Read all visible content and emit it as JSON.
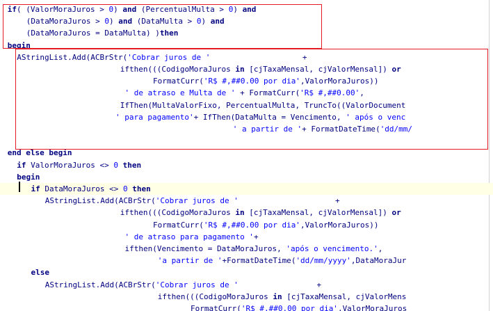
{
  "editor": {
    "lines": [
      {
        "indent": 1,
        "tokens": [
          {
            "t": "kw",
            "v": "if"
          },
          {
            "t": "sym",
            "v": "( ("
          },
          {
            "t": "id",
            "v": "ValorMoraJuros"
          },
          {
            "t": "sym",
            "v": " > "
          },
          {
            "t": "num",
            "v": "0"
          },
          {
            "t": "sym",
            "v": ") "
          },
          {
            "t": "kw",
            "v": "and"
          },
          {
            "t": "sym",
            "v": " ("
          },
          {
            "t": "id",
            "v": "PercentualMulta"
          },
          {
            "t": "sym",
            "v": " > "
          },
          {
            "t": "num",
            "v": "0"
          },
          {
            "t": "sym",
            "v": ") "
          },
          {
            "t": "kw",
            "v": "and"
          }
        ]
      },
      {
        "indent": 5,
        "tokens": [
          {
            "t": "sym",
            "v": "("
          },
          {
            "t": "id",
            "v": "DataMoraJuros"
          },
          {
            "t": "sym",
            "v": " > "
          },
          {
            "t": "num",
            "v": "0"
          },
          {
            "t": "sym",
            "v": ") "
          },
          {
            "t": "kw",
            "v": "and"
          },
          {
            "t": "sym",
            "v": " ("
          },
          {
            "t": "id",
            "v": "DataMulta"
          },
          {
            "t": "sym",
            "v": " > "
          },
          {
            "t": "num",
            "v": "0"
          },
          {
            "t": "sym",
            "v": ") "
          },
          {
            "t": "kw",
            "v": "and"
          }
        ]
      },
      {
        "indent": 5,
        "tokens": [
          {
            "t": "sym",
            "v": "("
          },
          {
            "t": "id",
            "v": "DataMoraJuros"
          },
          {
            "t": "sym",
            "v": " = "
          },
          {
            "t": "id",
            "v": "DataMulta"
          },
          {
            "t": "sym",
            "v": ") )"
          },
          {
            "t": "kw",
            "v": "then"
          }
        ]
      },
      {
        "indent": 1,
        "tokens": [
          {
            "t": "kw",
            "v": "begin"
          }
        ]
      },
      {
        "indent": 3,
        "tokens": [
          {
            "t": "id",
            "v": "AStringList.Add"
          },
          {
            "t": "sym",
            "v": "("
          },
          {
            "t": "id",
            "v": "ACBrStr"
          },
          {
            "t": "sym",
            "v": "("
          },
          {
            "t": "str",
            "v": "'Cobrar juros de '"
          },
          {
            "t": "sym",
            "v": "                    +"
          }
        ]
      },
      {
        "indent": 25,
        "tokens": [
          {
            "t": "id",
            "v": "ifthen"
          },
          {
            "t": "sym",
            "v": "((("
          },
          {
            "t": "id",
            "v": "CodigoMoraJuros"
          },
          {
            "t": "sym",
            "v": " "
          },
          {
            "t": "kw",
            "v": "in"
          },
          {
            "t": "sym",
            "v": " ["
          },
          {
            "t": "id",
            "v": "cjTaxaMensal"
          },
          {
            "t": "sym",
            "v": ", "
          },
          {
            "t": "id",
            "v": "cjValorMensal"
          },
          {
            "t": "sym",
            "v": "]) "
          },
          {
            "t": "kw",
            "v": "or"
          }
        ]
      },
      {
        "indent": 32,
        "tokens": [
          {
            "t": "id",
            "v": "FormatCurr"
          },
          {
            "t": "sym",
            "v": "("
          },
          {
            "t": "str",
            "v": "'R$ #,##0.00 por dia'"
          },
          {
            "t": "sym",
            "v": ","
          },
          {
            "t": "id",
            "v": "ValorMoraJuros"
          },
          {
            "t": "sym",
            "v": "))"
          }
        ]
      },
      {
        "indent": 26,
        "tokens": [
          {
            "t": "str",
            "v": "' de atraso e Multa de '"
          },
          {
            "t": "sym",
            "v": " + "
          },
          {
            "t": "id",
            "v": "FormatCurr"
          },
          {
            "t": "sym",
            "v": "("
          },
          {
            "t": "str",
            "v": "'R$ #,##0.00'"
          },
          {
            "t": "sym",
            "v": ","
          }
        ]
      },
      {
        "indent": 25,
        "tokens": [
          {
            "t": "id",
            "v": "IfThen"
          },
          {
            "t": "sym",
            "v": "("
          },
          {
            "t": "id",
            "v": "MultaValorFixo"
          },
          {
            "t": "sym",
            "v": ", "
          },
          {
            "t": "id",
            "v": "PercentualMulta"
          },
          {
            "t": "sym",
            "v": ", "
          },
          {
            "t": "id",
            "v": "TruncTo"
          },
          {
            "t": "sym",
            "v": "(("
          },
          {
            "t": "id",
            "v": "ValorDocument"
          }
        ]
      },
      {
        "indent": 24,
        "tokens": [
          {
            "t": "str",
            "v": "' para pagamento'"
          },
          {
            "t": "sym",
            "v": "+ "
          },
          {
            "t": "id",
            "v": "IfThen"
          },
          {
            "t": "sym",
            "v": "("
          },
          {
            "t": "id",
            "v": "DataMulta"
          },
          {
            "t": "sym",
            "v": " = "
          },
          {
            "t": "id",
            "v": "Vencimento"
          },
          {
            "t": "sym",
            "v": ", "
          },
          {
            "t": "str",
            "v": "' após o venc"
          }
        ]
      },
      {
        "indent": 49,
        "tokens": [
          {
            "t": "str",
            "v": "' a partir de '"
          },
          {
            "t": "sym",
            "v": "+ "
          },
          {
            "t": "id",
            "v": "FormatDateTime"
          },
          {
            "t": "sym",
            "v": "("
          },
          {
            "t": "str",
            "v": "'dd/mm/"
          }
        ]
      },
      {
        "indent": 0,
        "tokens": []
      },
      {
        "indent": 1,
        "tokens": [
          {
            "t": "kw",
            "v": "end else begin"
          }
        ]
      },
      {
        "indent": 3,
        "tokens": [
          {
            "t": "kw",
            "v": "if"
          },
          {
            "t": "sym",
            "v": " "
          },
          {
            "t": "id",
            "v": "ValorMoraJuros"
          },
          {
            "t": "sym",
            "v": " <> "
          },
          {
            "t": "num",
            "v": "0"
          },
          {
            "t": "sym",
            "v": " "
          },
          {
            "t": "kw",
            "v": "then"
          }
        ]
      },
      {
        "indent": 3,
        "tokens": [
          {
            "t": "kw",
            "v": "begin"
          }
        ]
      },
      {
        "indent": 6,
        "current": true,
        "tokens": [
          {
            "t": "kw",
            "v": "if"
          },
          {
            "t": "sym",
            "v": " "
          },
          {
            "t": "id",
            "v": "DataMoraJuros"
          },
          {
            "t": "sym",
            "v": " <> "
          },
          {
            "t": "num",
            "v": "0"
          },
          {
            "t": "sym",
            "v": " "
          },
          {
            "t": "kw",
            "v": "then"
          }
        ]
      },
      {
        "indent": 9,
        "tokens": [
          {
            "t": "id",
            "v": "AStringList.Add"
          },
          {
            "t": "sym",
            "v": "("
          },
          {
            "t": "id",
            "v": "ACBrStr"
          },
          {
            "t": "sym",
            "v": "("
          },
          {
            "t": "str",
            "v": "'Cobrar juros de '"
          },
          {
            "t": "sym",
            "v": "                     +"
          }
        ]
      },
      {
        "indent": 25,
        "tokens": [
          {
            "t": "id",
            "v": "ifthen"
          },
          {
            "t": "sym",
            "v": "((("
          },
          {
            "t": "id",
            "v": "CodigoMoraJuros"
          },
          {
            "t": "sym",
            "v": " "
          },
          {
            "t": "kw",
            "v": "in"
          },
          {
            "t": "sym",
            "v": " ["
          },
          {
            "t": "id",
            "v": "cjTaxaMensal"
          },
          {
            "t": "sym",
            "v": ", "
          },
          {
            "t": "id",
            "v": "cjValorMensal"
          },
          {
            "t": "sym",
            "v": "]) "
          },
          {
            "t": "kw",
            "v": "or"
          }
        ]
      },
      {
        "indent": 32,
        "tokens": [
          {
            "t": "id",
            "v": "FormatCurr"
          },
          {
            "t": "sym",
            "v": "("
          },
          {
            "t": "str",
            "v": "'R$ #,##0.00 por dia'"
          },
          {
            "t": "sym",
            "v": ","
          },
          {
            "t": "id",
            "v": "ValorMoraJuros"
          },
          {
            "t": "sym",
            "v": "))"
          }
        ]
      },
      {
        "indent": 26,
        "tokens": [
          {
            "t": "str",
            "v": "' de atraso para pagamento '"
          },
          {
            "t": "sym",
            "v": "+"
          }
        ]
      },
      {
        "indent": 26,
        "tokens": [
          {
            "t": "id",
            "v": "ifthen"
          },
          {
            "t": "sym",
            "v": "("
          },
          {
            "t": "id",
            "v": "Vencimento"
          },
          {
            "t": "sym",
            "v": " = "
          },
          {
            "t": "id",
            "v": "DataMoraJuros"
          },
          {
            "t": "sym",
            "v": ", "
          },
          {
            "t": "str",
            "v": "'após o vencimento.'"
          },
          {
            "t": "sym",
            "v": ","
          }
        ]
      },
      {
        "indent": 33,
        "tokens": [
          {
            "t": "str",
            "v": "'a partir de '"
          },
          {
            "t": "sym",
            "v": "+"
          },
          {
            "t": "id",
            "v": "FormatDateTime"
          },
          {
            "t": "sym",
            "v": "("
          },
          {
            "t": "str",
            "v": "'dd/mm/yyyy'"
          },
          {
            "t": "sym",
            "v": ","
          },
          {
            "t": "id",
            "v": "DataMoraJur"
          }
        ]
      },
      {
        "indent": 6,
        "tokens": [
          {
            "t": "kw",
            "v": "else"
          }
        ]
      },
      {
        "indent": 9,
        "tokens": [
          {
            "t": "id",
            "v": "AStringList.Add"
          },
          {
            "t": "sym",
            "v": "("
          },
          {
            "t": "id",
            "v": "ACBrStr"
          },
          {
            "t": "sym",
            "v": "("
          },
          {
            "t": "str",
            "v": "'Cobrar juros de '"
          },
          {
            "t": "sym",
            "v": "                 +"
          }
        ]
      },
      {
        "indent": 33,
        "tokens": [
          {
            "t": "id",
            "v": "ifthen"
          },
          {
            "t": "sym",
            "v": "((("
          },
          {
            "t": "id",
            "v": "CodigoMoraJuros"
          },
          {
            "t": "sym",
            "v": " "
          },
          {
            "t": "kw",
            "v": "in"
          },
          {
            "t": "sym",
            "v": " ["
          },
          {
            "t": "id",
            "v": "cjTaxaMensal"
          },
          {
            "t": "sym",
            "v": ", "
          },
          {
            "t": "id",
            "v": "cjValorMens"
          }
        ]
      },
      {
        "indent": 40,
        "tokens": [
          {
            "t": "id",
            "v": "FormatCurr"
          },
          {
            "t": "sym",
            "v": "("
          },
          {
            "t": "str",
            "v": "'R$ #,##0.00 por dia'"
          },
          {
            "t": "sym",
            "v": ","
          },
          {
            "t": "id",
            "v": "ValorMoraJuros"
          }
        ]
      }
    ]
  }
}
